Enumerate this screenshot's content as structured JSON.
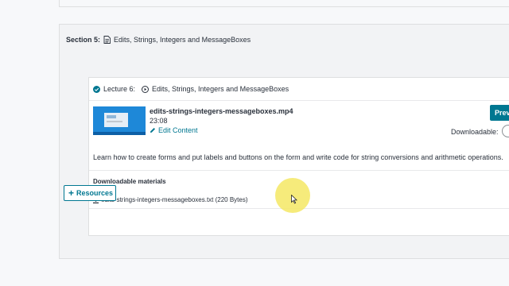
{
  "section": {
    "label": "Section 5:",
    "title": "Edits, Strings, Integers and MessageBoxes"
  },
  "lecture": {
    "label": "Lecture 6:",
    "title": "Edits, Strings, Integers and MessageBoxes",
    "file_name": "edits-strings-integers-messageboxes.mp4",
    "duration": "23:08",
    "edit_label": "Edit Content",
    "preview_label": "Preview",
    "downloadable_label": "Downloadable:",
    "description": "Learn how to create forms and put labels and buttons on the form and write code for string conversions and arithmetic operations."
  },
  "materials": {
    "heading": "Downloadable materials",
    "files": [
      "edits-strings-integers-messageboxes.txt (220 Bytes)"
    ]
  },
  "resources_label": "Resources",
  "colors": {
    "accent": "#007791",
    "check": "#007791",
    "highlight": "#f5e864"
  },
  "icons": {
    "section": "document-icon",
    "lecture_status": "check-circle-icon",
    "lecture_type": "play-circle-icon",
    "edit": "pencil-icon",
    "download": "download-icon",
    "resources": "plus-icon"
  }
}
